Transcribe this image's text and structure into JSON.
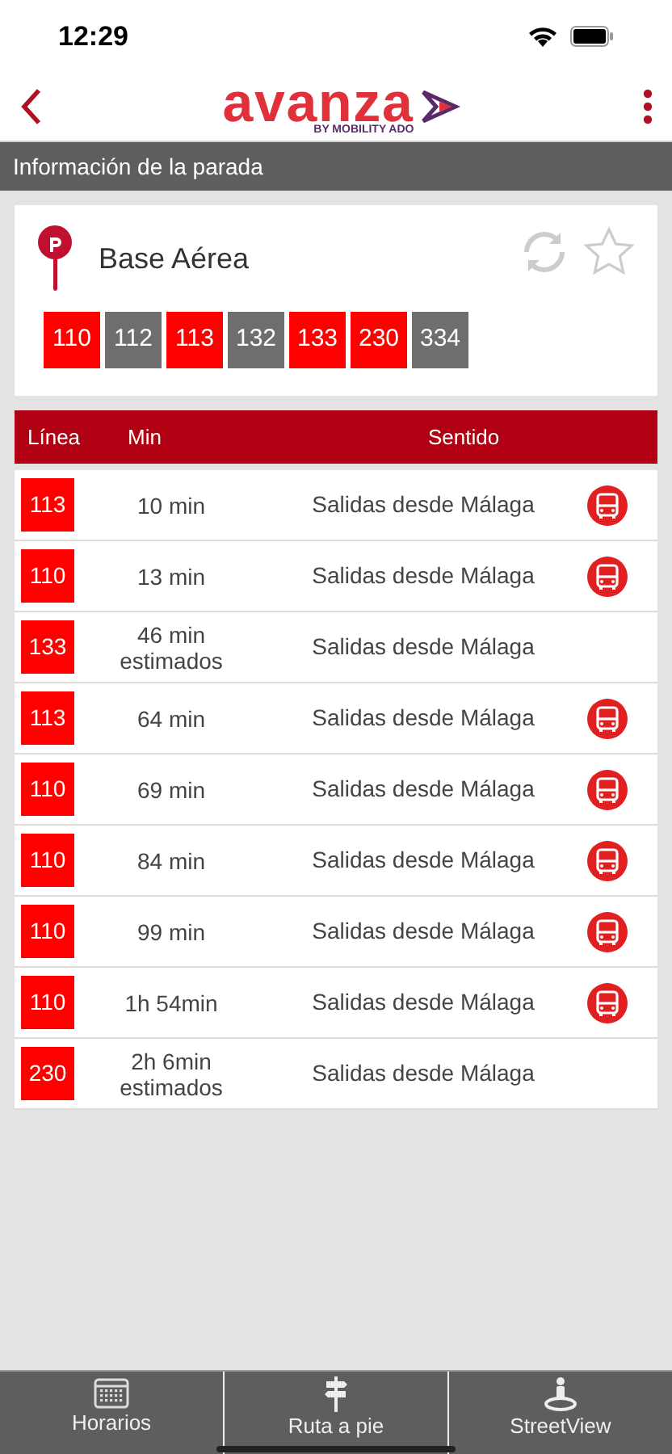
{
  "status_bar": {
    "time": "12:29"
  },
  "header": {
    "logo": "avanza",
    "logo_sub": "BY MOBILITY ADO"
  },
  "section_title": "Información de la parada",
  "stop": {
    "name": "Base Aérea",
    "favorite": false,
    "lines": [
      {
        "label": "110",
        "color": "#ff0000"
      },
      {
        "label": "112",
        "color": "#6e6e6e"
      },
      {
        "label": "113",
        "color": "#ff0000"
      },
      {
        "label": "132",
        "color": "#6e6e6e"
      },
      {
        "label": "133",
        "color": "#ff0000"
      },
      {
        "label": "230",
        "color": "#ff0000"
      },
      {
        "label": "334",
        "color": "#6e6e6e"
      }
    ]
  },
  "table": {
    "columns": [
      "Línea",
      "Min",
      "Sentido"
    ],
    "rows": [
      {
        "line": "113",
        "min": "10 min",
        "direction": "Salidas desde Málaga",
        "realtime": true
      },
      {
        "line": "110",
        "min": "13 min",
        "direction": "Salidas desde Málaga",
        "realtime": true
      },
      {
        "line": "133",
        "min": "46 min estimados",
        "direction": "Salidas desde Málaga",
        "realtime": false
      },
      {
        "line": "113",
        "min": "64 min",
        "direction": "Salidas desde Málaga",
        "realtime": true
      },
      {
        "line": "110",
        "min": "69 min",
        "direction": "Salidas desde Málaga",
        "realtime": true
      },
      {
        "line": "110",
        "min": "84 min",
        "direction": "Salidas desde Málaga",
        "realtime": true
      },
      {
        "line": "110",
        "min": "99 min",
        "direction": "Salidas desde Málaga",
        "realtime": true
      },
      {
        "line": "110",
        "min": "1h 54min",
        "direction": "Salidas desde Málaga",
        "realtime": true
      },
      {
        "line": "230",
        "min": "2h 6min estimados",
        "direction": "Salidas desde Málaga",
        "realtime": false
      }
    ]
  },
  "bottom_tabs": [
    {
      "label": "Horarios"
    },
    {
      "label": "Ruta a pie"
    },
    {
      "label": "StreetView"
    }
  ]
}
